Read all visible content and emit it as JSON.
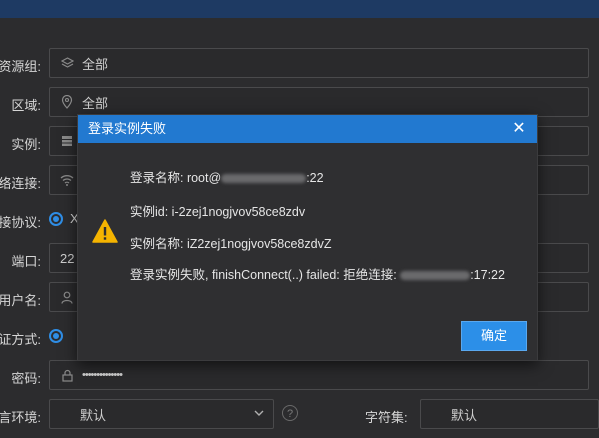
{
  "form": {
    "resource_group": {
      "label": "资源组:",
      "value": "全部"
    },
    "region": {
      "label": "区域:",
      "value": "全部"
    },
    "instance": {
      "label": "实例:"
    },
    "network": {
      "label": "网络连接:"
    },
    "protocol": {
      "label": "连接协议:",
      "option_prefix": "X"
    },
    "port": {
      "label": "端口:",
      "value": "22"
    },
    "username": {
      "label": "用户名:"
    },
    "auth": {
      "label": "认证方式:"
    },
    "password": {
      "label": "密码:",
      "value": "••••••••••••••"
    },
    "locale": {
      "label": "语言环境:",
      "value": "默认"
    },
    "charset": {
      "label": "字符集:",
      "value": "默认"
    }
  },
  "dialog": {
    "title": "登录实例失败",
    "close_label": "✕",
    "lines": {
      "login_name_prefix": "登录名称: root@",
      "login_name_suffix": ":22",
      "instance_id": "实例id: i-2zej1nogjvov58ce8zdv",
      "instance_name": "实例名称: iZ2zej1nogjvov58ce8zdvZ",
      "error_prefix": "登录实例失败, finishConnect(..) failed: 拒绝连接: ",
      "error_suffix": ":17:22"
    },
    "ok_label": "确定",
    "accent": "#2279d0"
  }
}
